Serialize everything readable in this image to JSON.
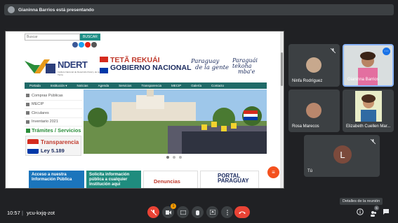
{
  "presenter_bar": {
    "text": "Gianinna Barrios está presentando"
  },
  "shared_screen": {
    "search": {
      "placeholder": "Buscar",
      "button": "BUSCAR"
    },
    "logo": {
      "name": "NDERT",
      "subtitle": "Instituto Nacional de Desarrollo Rural y de la Tierra"
    },
    "gov": {
      "line1": "TETÃ REKUÁI",
      "line2": "GOBIERNO NACIONAL"
    },
    "slogan1": [
      "Paraguay",
      "de la gente"
    ],
    "slogan2": [
      "Paraguái",
      "tekoha",
      "mba'e"
    ],
    "nav": [
      "Portada",
      "Institución ▾",
      "Noticias",
      "Agenda",
      "Servicios",
      "Transparencia",
      "MECIP",
      "Galería",
      "Contacto"
    ],
    "side_items": [
      "Compras Públicas",
      "MECIP",
      "Circulares",
      "Inventario 2021"
    ],
    "tramites": "Trámites / Servicios",
    "transparency": {
      "title": "Transparencia",
      "law": "Ley 5.189"
    },
    "banners": [
      {
        "line1": "Acceso a nuestra",
        "line2": "Información Pública"
      },
      {
        "line1": "Solicita información",
        "line2": "pública a cualquier",
        "line3": "Institución aquí"
      },
      {
        "line1": "Denuncias"
      },
      {
        "line1": "PORTAL",
        "line2": "PARAGUAY"
      }
    ]
  },
  "participants": [
    {
      "name": "Ninfa Rodríguez",
      "muted": true
    },
    {
      "name": "Gianinna Barrios",
      "muted": false
    },
    {
      "name": "Rosa Marecos",
      "muted": false
    },
    {
      "name": "Elizabeth Cuellen Mar...",
      "muted": false
    },
    {
      "name": "Tú",
      "initial": "L",
      "muted": true
    }
  ],
  "bottom_bar": {
    "time": "10:57",
    "separator": "|",
    "meeting_code": "ycu-kxjq-zot",
    "tooltip": "Detalles de la reunión",
    "badge_count": "1",
    "people_count": "5"
  },
  "colors": {
    "background": "#202124",
    "tile": "#3c4043",
    "danger": "#ea4335",
    "accent": "#1a73e8"
  }
}
